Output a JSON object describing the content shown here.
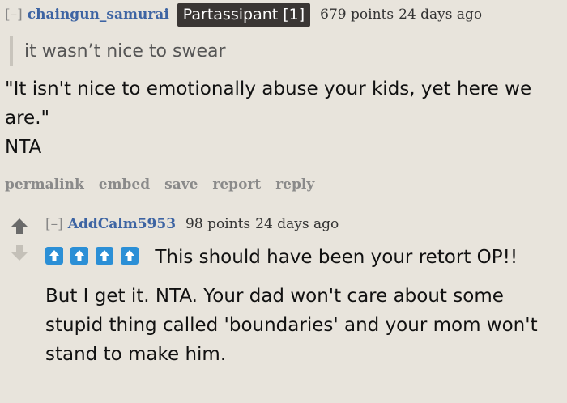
{
  "parent_comment": {
    "expand_label": "[–]",
    "author": "chaingun_samurai",
    "flair": "Partassipant [1]",
    "score": "679 points",
    "time": "24 days ago",
    "quote": "it wasn’t nice to swear",
    "body_line1": "\"It isn't nice to emotionally abuse your kids, yet here we are.\"",
    "body_line2": "NTA",
    "buttons": {
      "permalink": "permalink",
      "embed": "embed",
      "save": "save",
      "report": "report",
      "reply": "reply"
    }
  },
  "child_comment": {
    "expand_label": "[–]",
    "author": "AddCalm5953",
    "score": "98 points",
    "time": "24 days ago",
    "emoji_icon": "up-arrow-emoji-icon",
    "emoji_color": "#2b8fd6",
    "paragraph1": "This should have been your retort OP!!",
    "paragraph2": "But I get it. NTA. Your dad won't care about some stupid thing called 'boundaries' and your mom won't stand to make him."
  }
}
